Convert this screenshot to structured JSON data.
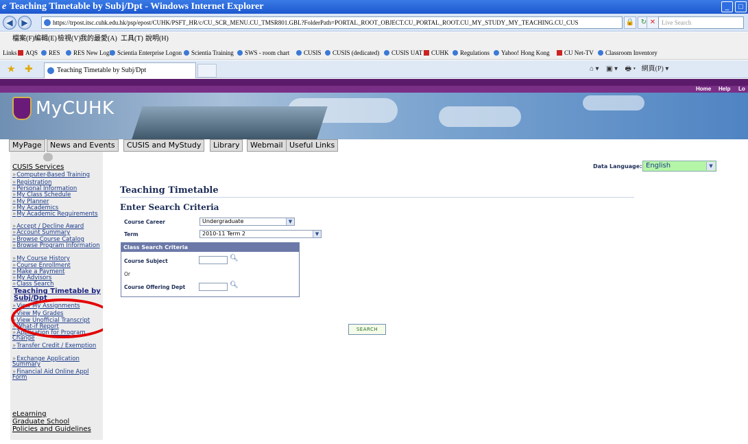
{
  "window": {
    "title": "Teaching Timetable by Subj/Dpt - Windows Internet Explorer"
  },
  "address_bar": {
    "url": "https://trpost.itsc.cuhk.edu.hk/psp/epost/CUHK/PSFT_HR/c/CU_SCR_MENU.CU_TMSR801.GBL?FolderPath=PORTAL_ROOT_OBJECT.CU_PORTAL_ROOT.CU_MY_STUDY_MY_TEACHING.CU_CUS",
    "search_placeholder": "Live Search"
  },
  "menu": {
    "items": [
      "檔案(F)",
      "編輯(E)",
      "檢視(V)",
      "我的最愛(A)",
      "工具(T)",
      "說明(H)"
    ]
  },
  "links_bar": {
    "label": "Links",
    "items": [
      "AQS",
      "RES",
      "RES New Login",
      "Scientia Enterprise Logon",
      "Scientia Training",
      "SWS - room chart",
      "CUSIS",
      "CUSIS (dedicated)",
      "CUSIS UAT",
      "CUHK",
      "Regulations",
      "Yahoo! Hong Kong",
      "CU Net-TV",
      "Classroom Inventory"
    ]
  },
  "tab": {
    "label": "Teaching Timetable by Subj/Dpt"
  },
  "command_bar": {
    "page_label": "網頁(P)"
  },
  "utility_links": {
    "home": "Home",
    "help": "Help",
    "logout": "Lo"
  },
  "banner": {
    "logo_text": "MyCUHK"
  },
  "portal_tabs": [
    "MyPage",
    "News and Events",
    "CUSIS and MyStudy",
    "Library",
    "Webmail",
    "Useful Links"
  ],
  "sidebar": {
    "section_title": "CUSIS Services",
    "items": [
      "Computer-Based Training",
      "Registration",
      "Personal Information",
      "My Class Schedule",
      "My Planner",
      "My Academics",
      "My Academic Requirements",
      "Accept / Decline Award",
      "Account Summary",
      "Browse Course Catalog",
      "Browse Program Information",
      "My Course History",
      "Course Enrollment",
      "Make a Payment",
      "My Advisors",
      "Class Search",
      "Teaching Timetable by Subj/Dpt",
      "View My Assignments",
      "View My Grades",
      "View Unofficial Transcript",
      "What-if Report",
      "Application for Program Change",
      "Transfer Credit / Exemption",
      "Exchange Application Summary",
      "Financial Aid Online Appl Form"
    ],
    "bottom_sections": [
      "eLearning",
      "Graduate School",
      "Policies and Guidelines"
    ]
  },
  "main": {
    "data_language_label": "Data Language:",
    "data_language_value": "English",
    "page_title": "Teaching Timetable",
    "subtitle": "Enter Search Criteria",
    "course_career_label": "Course Career",
    "course_career_value": "Undergraduate",
    "term_label": "Term",
    "term_value": "2010-11 Term 2",
    "criteria_header": "Class Search Criteria",
    "course_subject_label": "Course Subject",
    "or_label": "Or",
    "course_dept_label": "Course Offering Dept",
    "search_button": "SEARCH"
  },
  "colors": {
    "purple_header": "#5b1a6a",
    "title_navy": "#1d2d57",
    "link_blue": "#1a3a8a",
    "annotation_red": "#e30000",
    "language_select_bg": "#b5f5a8"
  }
}
